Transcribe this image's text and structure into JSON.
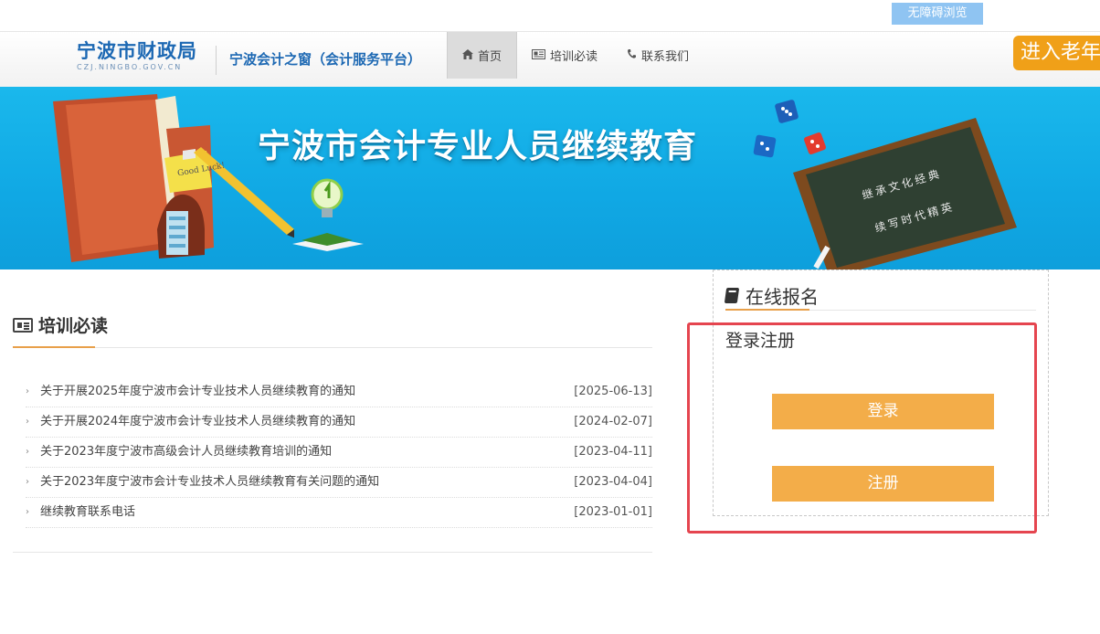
{
  "top_strip": {
    "accessibility_label": "无障碍浏览"
  },
  "header": {
    "logo_cn": "宁波市财政局",
    "logo_en": "CZJ.NINGBO.GOV.CN",
    "site_subtitle": "宁波会计之窗（会计服务平台）",
    "nav": [
      {
        "label": "首页",
        "icon": "home-icon",
        "active": true
      },
      {
        "label": "培训必读",
        "icon": "newspaper-icon",
        "active": false
      },
      {
        "label": "联系我们",
        "icon": "phone-icon",
        "active": false
      }
    ],
    "elder_mode": "进入老年"
  },
  "banner": {
    "title": "宁波市会计专业人员继续教育",
    "book_note": "Good Luck!",
    "chalkboard_lines": [
      "继承文化经典",
      "续写时代精英"
    ]
  },
  "news": {
    "section_title": "培训必读",
    "items": [
      {
        "title": "关于开展2025年度宁波市会计专业技术人员继续教育的通知",
        "date": "[2025-06-13]"
      },
      {
        "title": "关于开展2024年度宁波市会计专业技术人员继续教育的通知",
        "date": "[2024-02-07]"
      },
      {
        "title": "关于2023年度宁波市高级会计人员继续教育培训的通知",
        "date": "[2023-04-11]"
      },
      {
        "title": "关于2023年度宁波市会计专业技术人员继续教育有关问题的通知",
        "date": "[2023-04-04]"
      },
      {
        "title": "继续教育联系电话",
        "date": "[2023-01-01]"
      }
    ]
  },
  "registration": {
    "title": "在线报名",
    "subtitle": "登录注册",
    "login_label": "登录",
    "register_label": "注册"
  },
  "colors": {
    "accent_orange": "#f3ad49",
    "brand_blue": "#1c68b3",
    "banner_blue": "#12aae5",
    "highlight_red": "#e5454f"
  }
}
